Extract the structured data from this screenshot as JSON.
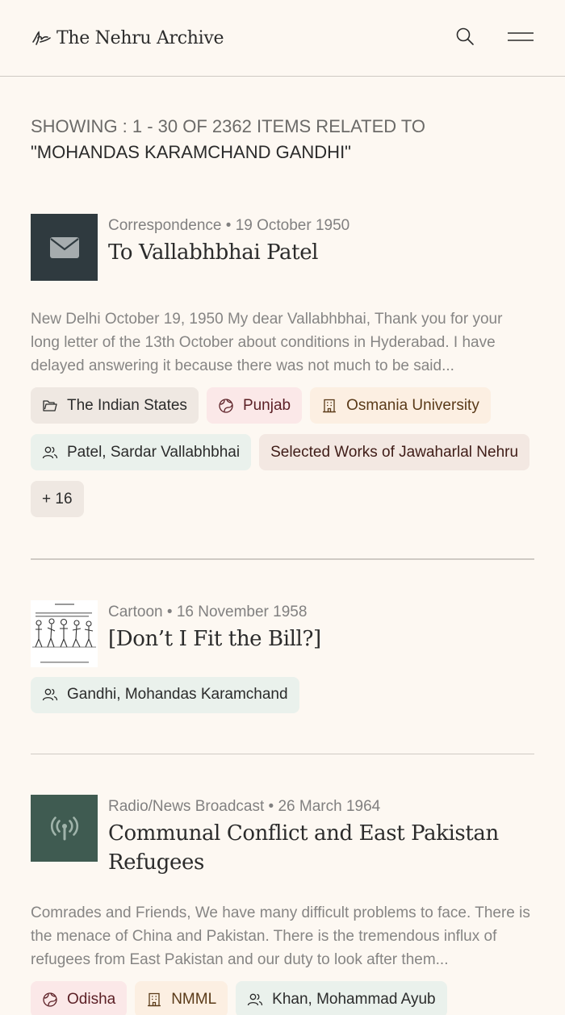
{
  "header": {
    "site_title": "The Nehru Archive",
    "logo_icon": "signature-icon",
    "search_icon": "search-icon",
    "menu_icon": "menu-icon"
  },
  "summary": {
    "prefix": "SHOWING : 1 - 30 OF 2362 ITEMS RELATED TO ",
    "query": "\"MOHANDAS KARAMCHAND GANDHI\""
  },
  "results": [
    {
      "type": "Correspondence",
      "date": "19 October 1950",
      "title": "To Vallabhbhai Patel",
      "thumb_icon": "envelope-icon",
      "excerpt": "New Delhi October 19, 1950 My dear Vallabhbhai, Thank you for your long letter of the 13th October about conditions in Hyderabad. I have delayed answering it because there was not much to be said...",
      "tags": [
        {
          "label": "The Indian States",
          "icon": "folder-icon"
        },
        {
          "label": "Punjab",
          "icon": "globe-icon"
        },
        {
          "label": "Osmania University",
          "icon": "building-icon"
        },
        {
          "label": "Patel, Sardar Vallabhbhai",
          "icon": "people-icon"
        },
        {
          "label": "Selected Works of Jawaharlal Nehru",
          "icon": ""
        },
        {
          "label": "+ 16",
          "icon": ""
        }
      ]
    },
    {
      "type": "Cartoon",
      "date": "16 November 1958",
      "title": "[Don’t I Fit the Bill?]",
      "thumb_icon": "cartoon-thumbnail",
      "tags": [
        {
          "label": "Gandhi, Mohandas Karamchand",
          "icon": "people-icon"
        }
      ]
    },
    {
      "type": "Radio/News Broadcast",
      "date": "26 March 1964",
      "title": "Communal Conflict and East Pakistan Refugees",
      "thumb_icon": "broadcast-icon",
      "excerpt": "Comrades and Friends, We have many difficult problems to face. There is the menace of China and Pakistan. There is the tremendous influx of refugees from East Pakistan and our duty to look after them...",
      "tags": [
        {
          "label": "Odisha",
          "icon": "globe-icon"
        },
        {
          "label": "NMML",
          "icon": "building-icon"
        },
        {
          "label": "Khan, Mohammad Ayub",
          "icon": "people-icon"
        }
      ]
    }
  ],
  "meta_separator": "•",
  "colors": {
    "background": "#fdf8f2",
    "thumb_dark": "#2f3a3f",
    "thumb_green": "#3f5b51",
    "place_tag_bg": "#fbe8e8",
    "org_tag_bg": "#fcefe2",
    "person_tag_bg": "#eaf1ec"
  }
}
